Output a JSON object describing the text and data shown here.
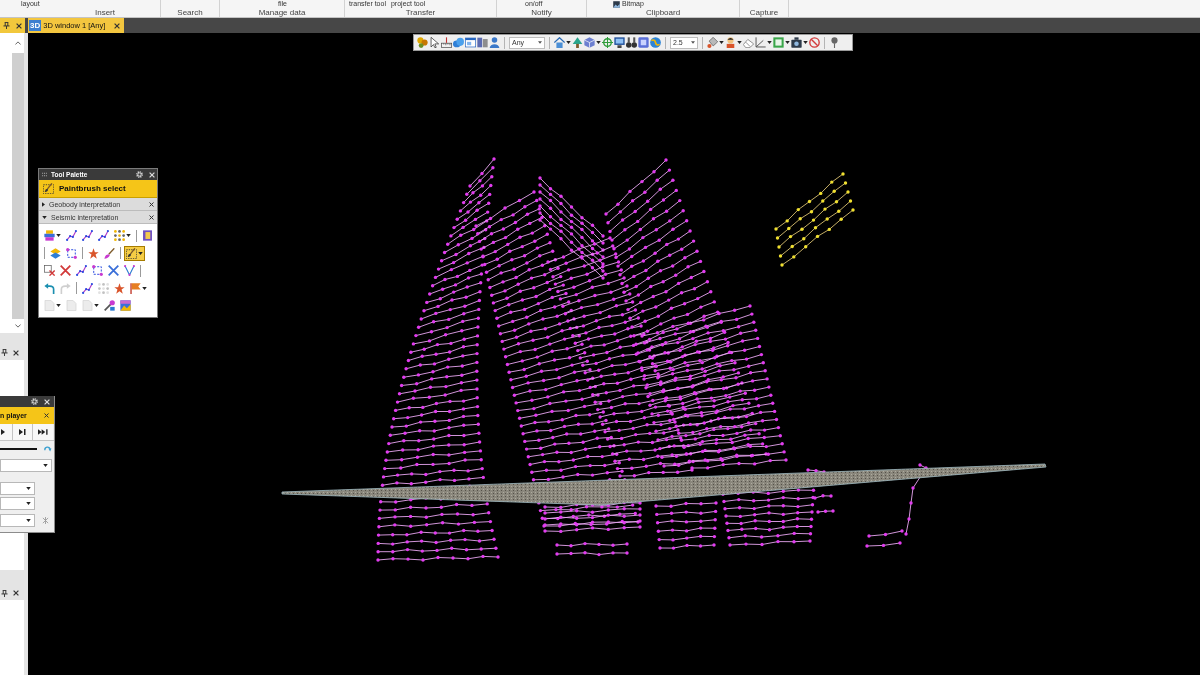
{
  "ribbon": {
    "groups": [
      {
        "label": "Insert",
        "commands": [
          {
            "kind": "text",
            "label": "layout"
          }
        ]
      },
      {
        "label": "Search"
      },
      {
        "label": "Manage data",
        "commands": [
          {
            "kind": "text",
            "label": "file"
          }
        ]
      },
      {
        "label": "Transfer",
        "commands": [
          {
            "kind": "text",
            "label": "transfer tool"
          },
          {
            "kind": "text",
            "label": "project tool"
          }
        ]
      },
      {
        "label": "Notify",
        "commands": [
          {
            "kind": "text",
            "label": "on/off"
          }
        ]
      },
      {
        "label": "Clipboard",
        "commands": [
          {
            "kind": "icon_text",
            "label": "Bitmap"
          }
        ]
      },
      {
        "label": "Capture"
      }
    ]
  },
  "document_tabs": [
    {
      "icon_text": "3D",
      "label": "3D window 1 [Any]",
      "selected": true
    }
  ],
  "view_toolbar": {
    "items": [
      {
        "kind": "tool",
        "dropdown": false
      },
      {
        "kind": "tool",
        "dropdown": false
      },
      {
        "kind": "tool",
        "dropdown": false
      },
      {
        "kind": "tool",
        "dropdown": false
      },
      {
        "kind": "tool",
        "dropdown": false
      },
      {
        "kind": "tool",
        "dropdown": false
      },
      {
        "kind": "tool",
        "dropdown": false
      },
      {
        "kind": "separator"
      },
      {
        "kind": "combo",
        "value": "Any"
      },
      {
        "kind": "separator"
      },
      {
        "kind": "tool",
        "dropdown": true
      },
      {
        "kind": "tool",
        "dropdown": false
      },
      {
        "kind": "tool",
        "dropdown": true
      },
      {
        "kind": "tool",
        "dropdown": false
      },
      {
        "kind": "tool",
        "dropdown": false
      },
      {
        "kind": "tool",
        "dropdown": false
      },
      {
        "kind": "tool",
        "dropdown": false
      },
      {
        "kind": "tool",
        "dropdown": false
      },
      {
        "kind": "separator"
      },
      {
        "kind": "combo",
        "value": "2.5"
      },
      {
        "kind": "separator"
      },
      {
        "kind": "tool",
        "dropdown": true
      },
      {
        "kind": "tool",
        "dropdown": true
      },
      {
        "kind": "tool",
        "dropdown": false
      },
      {
        "kind": "tool",
        "dropdown": true
      },
      {
        "kind": "tool",
        "dropdown": true
      },
      {
        "kind": "tool",
        "dropdown": true
      },
      {
        "kind": "tool",
        "dropdown": false
      },
      {
        "kind": "separator"
      },
      {
        "kind": "tool",
        "dropdown": false
      }
    ]
  },
  "tool_palette": {
    "title": "Tool Palette",
    "active_tool": "Paintbrush select",
    "sections": [
      {
        "label": "Geobody interpretation",
        "expanded": false
      },
      {
        "label": "Seismic interpretation",
        "expanded": true,
        "tool_rows": [
          [
            {
              "kind": "tool",
              "dropdown": true,
              "selected": false,
              "disabled": false
            },
            {
              "kind": "tool",
              "dropdown": false,
              "selected": false,
              "disabled": false
            },
            {
              "kind": "tool",
              "dropdown": false,
              "selected": false,
              "disabled": false
            },
            {
              "kind": "tool",
              "dropdown": false,
              "selected": false,
              "disabled": false
            },
            {
              "kind": "tool",
              "dropdown": true,
              "selected": false,
              "disabled": false
            },
            {
              "kind": "separator"
            },
            {
              "kind": "tool",
              "dropdown": false,
              "selected": false,
              "disabled": false
            }
          ],
          [
            {
              "kind": "separator"
            },
            {
              "kind": "tool",
              "dropdown": false,
              "selected": false,
              "disabled": false
            },
            {
              "kind": "tool",
              "dropdown": false,
              "selected": false,
              "disabled": false
            },
            {
              "kind": "separator"
            },
            {
              "kind": "tool",
              "dropdown": false,
              "selected": false,
              "disabled": false
            },
            {
              "kind": "tool",
              "dropdown": false,
              "selected": false,
              "disabled": false
            },
            {
              "kind": "separator"
            },
            {
              "kind": "tool",
              "dropdown": true,
              "selected": true,
              "disabled": false
            }
          ],
          [
            {
              "kind": "tool",
              "dropdown": false,
              "selected": false,
              "disabled": false
            },
            {
              "kind": "tool",
              "dropdown": false,
              "selected": false,
              "disabled": false
            },
            {
              "kind": "tool",
              "dropdown": false,
              "selected": false,
              "disabled": false
            },
            {
              "kind": "tool",
              "dropdown": false,
              "selected": false,
              "disabled": false
            },
            {
              "kind": "tool",
              "dropdown": false,
              "selected": false,
              "disabled": false
            },
            {
              "kind": "tool",
              "dropdown": false,
              "selected": false,
              "disabled": false
            },
            {
              "kind": "separator"
            }
          ],
          [
            {
              "kind": "tool",
              "dropdown": false,
              "selected": false,
              "disabled": false
            },
            {
              "kind": "tool",
              "dropdown": false,
              "selected": false,
              "disabled": true
            },
            {
              "kind": "separator"
            },
            {
              "kind": "tool",
              "dropdown": false,
              "selected": false,
              "disabled": false
            },
            {
              "kind": "tool",
              "dropdown": false,
              "selected": false,
              "disabled": true
            },
            {
              "kind": "tool",
              "dropdown": false,
              "selected": false,
              "disabled": false
            },
            {
              "kind": "tool",
              "dropdown": true,
              "selected": false,
              "disabled": false
            }
          ],
          [
            {
              "kind": "tool",
              "dropdown": true,
              "selected": false,
              "disabled": true
            },
            {
              "kind": "tool",
              "dropdown": false,
              "selected": false,
              "disabled": true
            },
            {
              "kind": "tool",
              "dropdown": true,
              "selected": false,
              "disabled": true
            },
            {
              "kind": "tool",
              "dropdown": false,
              "selected": false,
              "disabled": false
            },
            {
              "kind": "tool",
              "dropdown": false,
              "selected": false,
              "disabled": false
            }
          ]
        ]
      }
    ]
  },
  "player": {
    "title": "n player"
  }
}
